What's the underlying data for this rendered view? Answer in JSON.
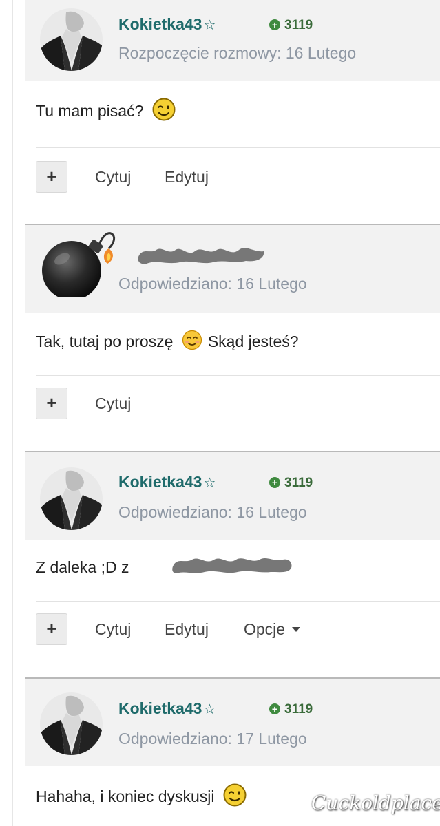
{
  "posts": [
    {
      "author": "Kokietka43",
      "star": "☆",
      "reputation": "3119",
      "reputation_icon": "plus-circle-icon",
      "meta": "Rozpoczęcie rozmowy: 16 Lutego",
      "text": "Tu mam pisać?",
      "emoji": "winking-face",
      "actions": {
        "plus": "+",
        "quote": "Cytuj",
        "edit": "Edytuj"
      }
    },
    {
      "author": "",
      "author_redacted": true,
      "meta": "Odpowiedziano: 16 Lutego",
      "text": "Tak, tutaj po proszę",
      "emoji": "smiling-face",
      "text_after": "Skąd jesteś?",
      "actions": {
        "plus": "+",
        "quote": "Cytuj"
      }
    },
    {
      "author": "Kokietka43",
      "star": "☆",
      "reputation": "3119",
      "reputation_icon": "plus-circle-icon",
      "meta": "Odpowiedziano: 16 Lutego",
      "text": "Z daleka ;D z",
      "text_redacted_tail": true,
      "actions": {
        "plus": "+",
        "quote": "Cytuj",
        "edit": "Edytuj",
        "options": "Opcje"
      }
    },
    {
      "author": "Kokietka43",
      "star": "☆",
      "reputation": "3119",
      "reputation_icon": "plus-circle-icon",
      "meta": "Odpowiedziano: 17 Lutego",
      "text": "Hahaha, i koniec dyskusji",
      "emoji": "winking-face"
    }
  ],
  "watermark": "Cuckoldplace",
  "colors": {
    "author": "#1f6b6b",
    "reputation": "#3a6b3a",
    "meta": "#8e97a3",
    "header_bg": "#f2f2f2",
    "separator": "#b9b9b9"
  }
}
